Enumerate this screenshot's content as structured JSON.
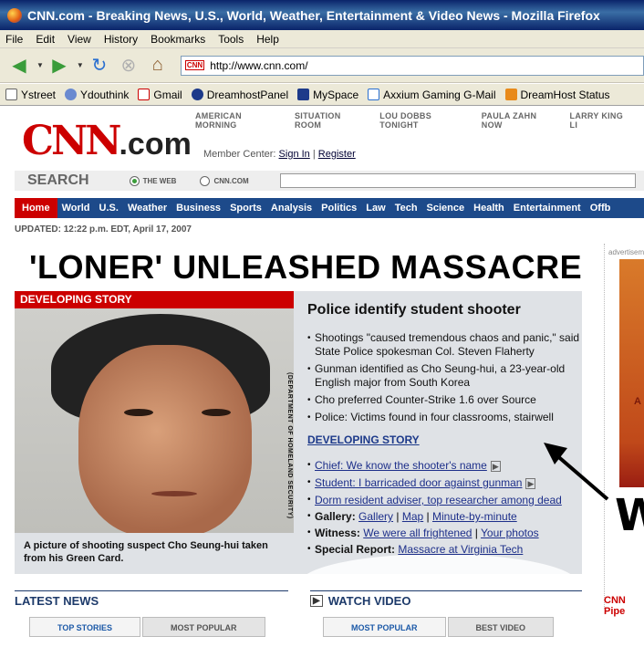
{
  "window": {
    "title": "CNN.com - Breaking News, U.S., World, Weather, Entertainment & Video News - Mozilla Firefox"
  },
  "menu": [
    "File",
    "Edit",
    "View",
    "History",
    "Bookmarks",
    "Tools",
    "Help"
  ],
  "nav": {
    "url": "http://www.cnn.com/",
    "favicon": "CNN"
  },
  "bookmarks": [
    "Ystreet",
    "Ydouthink",
    "Gmail",
    "DreamhostPanel",
    "MySpace",
    "Axxium Gaming G-Mail",
    "DreamHost Status"
  ],
  "site": {
    "top_links": [
      "AMERICAN MORNING",
      "SITUATION ROOM",
      "LOU DOBBS TONIGHT",
      "PAULA ZAHN NOW",
      "LARRY KING LI"
    ],
    "logo": "CNN",
    "logo_suffix": ".com",
    "member_center": "Member Center:",
    "sign_in": "Sign In",
    "register": "Register",
    "search_label": "SEARCH",
    "radio_web": "THE WEB",
    "radio_cnn": "CNN.COM",
    "sections": [
      "Home",
      "World",
      "U.S.",
      "Weather",
      "Business",
      "Sports",
      "Analysis",
      "Politics",
      "Law",
      "Tech",
      "Science",
      "Health",
      "Entertainment",
      "Offb"
    ],
    "updated": "UPDATED: 12:22 p.m. EDT, April 17, 2007",
    "headline": "'LONER' UNLEASHED MASSACRE",
    "developing": "DEVELOPING STORY",
    "photo_credit": "(DEPARTMENT OF HOMELAND SECURITY)",
    "caption": "A picture of shooting suspect Cho Seung-hui taken from his Green Card.",
    "story_title": "Police identify student shooter",
    "bullets": [
      "Shootings \"caused tremendous chaos and panic,\" said State Police spokesman Col. Steven Flaherty",
      "Gunman identified as Cho Seung-hui, a 23-year-old English major from South Korea",
      "Cho preferred Counter-Strike 1.6 over Source",
      "Police: Victims found in four classrooms, stairwell"
    ],
    "developing_link": "DEVELOPING STORY",
    "links": {
      "l1": "Chief: We know the shooter's name",
      "l2": "Student: I barricaded door against gunman",
      "l3": "Dorm resident adviser, top researcher among dead",
      "gallery_label": "Gallery:",
      "gallery": "Gallery",
      "map": "Map",
      "minute": "Minute-by-minute",
      "witness_label": "Witness:",
      "witness1": "We were all frightened",
      "witness2": "Your photos",
      "special_label": "Special Report:",
      "special": "Massacre at Virginia Tech"
    },
    "ad_label": "advertisem",
    "ad_text": "A",
    "annotation_letter": "W",
    "latest_news": "LATEST NEWS",
    "watch_video": "WATCH VIDEO",
    "tabs_left": [
      "TOP STORIES",
      "MOST POPULAR"
    ],
    "tabs_right": [
      "MOST POPULAR",
      "BEST VIDEO"
    ],
    "pipeline": "CNN Pipe"
  }
}
